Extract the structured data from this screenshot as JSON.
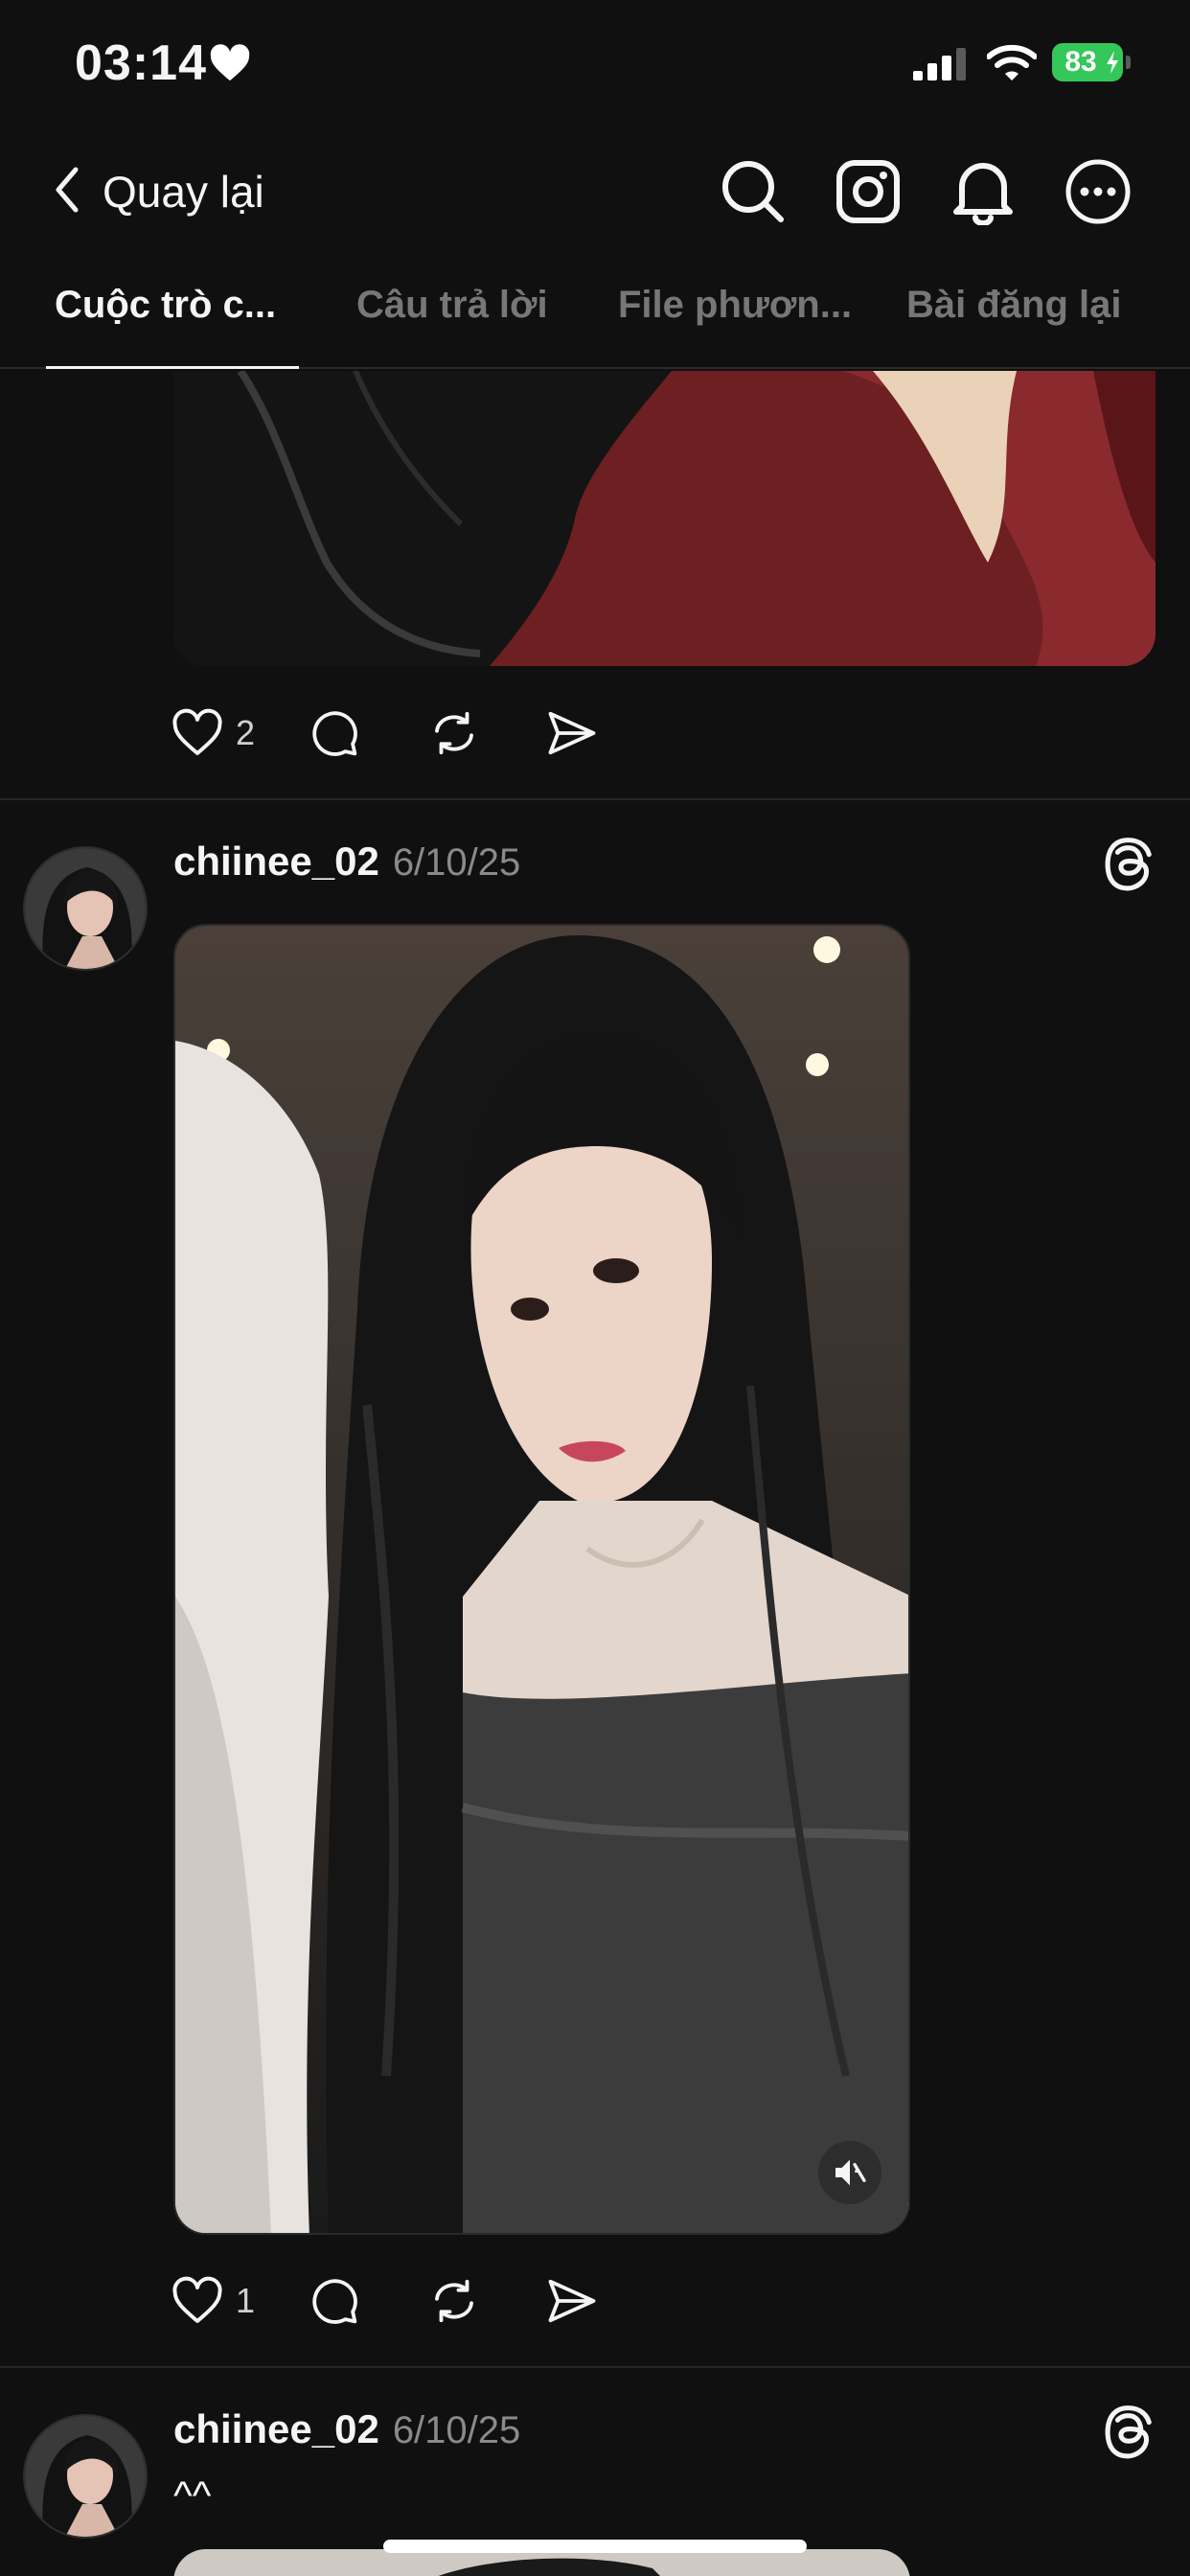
{
  "status_bar": {
    "time": "03:14",
    "battery": "83"
  },
  "header": {
    "back_label": "Quay lại",
    "icons": [
      "search-icon",
      "instagram-icon",
      "bell-icon",
      "more-icon"
    ]
  },
  "tabs": [
    {
      "label": "Cuộc trò c...",
      "active": true
    },
    {
      "label": "Câu trả lời",
      "active": false
    },
    {
      "label": "File phươn...",
      "active": false
    },
    {
      "label": "Bài đăng lại",
      "active": false
    }
  ],
  "posts": [
    {
      "like_count": "2"
    },
    {
      "username": "chiinee_02",
      "date": "6/10/25",
      "like_count": "1"
    },
    {
      "username": "chiinee_02",
      "date": "6/10/25",
      "text": "^^"
    }
  ],
  "colors": {
    "background": "#101010",
    "text": "#f3f5f7",
    "muted": "#777777",
    "battery": "#34c759"
  }
}
